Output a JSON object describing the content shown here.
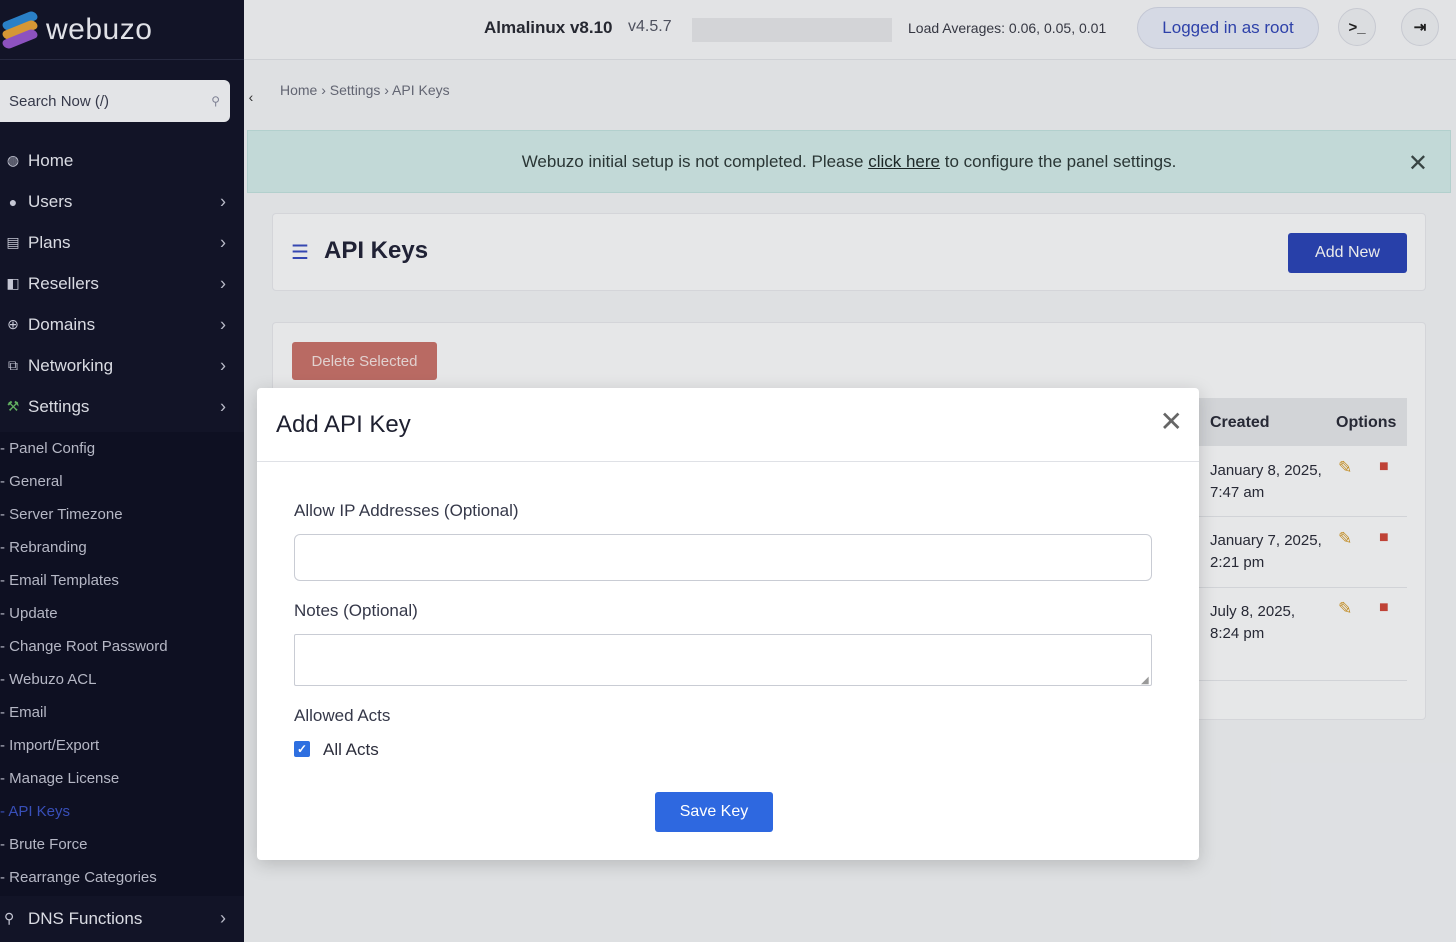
{
  "brand": {
    "name": "webuzo"
  },
  "search": {
    "placeholder": "Search Now (/)"
  },
  "nav": {
    "items": [
      {
        "label": "Home",
        "icon": "home-icon",
        "glyph": "◍",
        "chevron": false
      },
      {
        "label": "Users",
        "icon": "user-icon",
        "glyph": "●",
        "chevron": true
      },
      {
        "label": "Plans",
        "icon": "plans-icon",
        "glyph": "▤",
        "chevron": true
      },
      {
        "label": "Resellers",
        "icon": "resellers-icon",
        "glyph": "◧",
        "chevron": true
      },
      {
        "label": "Domains",
        "icon": "globe-icon",
        "glyph": "⊕",
        "chevron": true
      },
      {
        "label": "Networking",
        "icon": "network-icon",
        "glyph": "⧉",
        "chevron": true
      },
      {
        "label": "Settings",
        "icon": "wrench-icon",
        "glyph": "⚒",
        "chevron": true
      }
    ],
    "settings_sub": [
      "- Panel Config",
      "- General",
      "- Server Timezone",
      "- Rebranding",
      "- Email Templates",
      "- Update",
      "- Change Root Password",
      "- Webuzo ACL",
      "- Email",
      "- Import/Export",
      "- Manage License",
      "- API Keys",
      "- Brute Force",
      "- Rearrange Categories"
    ],
    "current_sub": "- API Keys",
    "dns": "DNS Functions"
  },
  "topbar": {
    "os": "Almalinux v8.10",
    "version": "v4.5.7",
    "load_averages": "Load Averages: 0.06, 0.05, 0.01",
    "logged_in": "Logged in as root",
    "terminal_glyph": ">_",
    "logout_glyph": "⇥"
  },
  "breadcrumb": "Home › Settings › API Keys",
  "alert": {
    "before": "Webuzo initial setup is not completed. Please ",
    "link": "click here",
    "after": " to configure the panel settings."
  },
  "page": {
    "title": "API Keys",
    "add_new": "Add New",
    "delete_selected": "Delete Selected"
  },
  "table": {
    "headers": {
      "created": "Created",
      "options": "Options"
    },
    "rows": [
      {
        "created": "January 8, 2025, 7:47 am"
      },
      {
        "created": "January 7, 2025, 2:21 pm"
      },
      {
        "created": "July 8, 2025, 8:24 pm"
      }
    ]
  },
  "modal": {
    "title": "Add API Key",
    "ip_label": "Allow IP Addresses (Optional)",
    "ip_value": "",
    "notes_label": "Notes (Optional)",
    "notes_value": "",
    "acts_label": "Allowed Acts",
    "all_acts_label": "All Acts",
    "all_acts_checked": true,
    "save": "Save Key"
  },
  "colors": {
    "sidebar_bg": "#14162b",
    "primary": "#2e68e0",
    "add_new": "#2c46b8",
    "danger": "#c9736c",
    "alert_bg": "#d3ecea",
    "edit": "#d39a2a",
    "trash": "#d0483b"
  }
}
